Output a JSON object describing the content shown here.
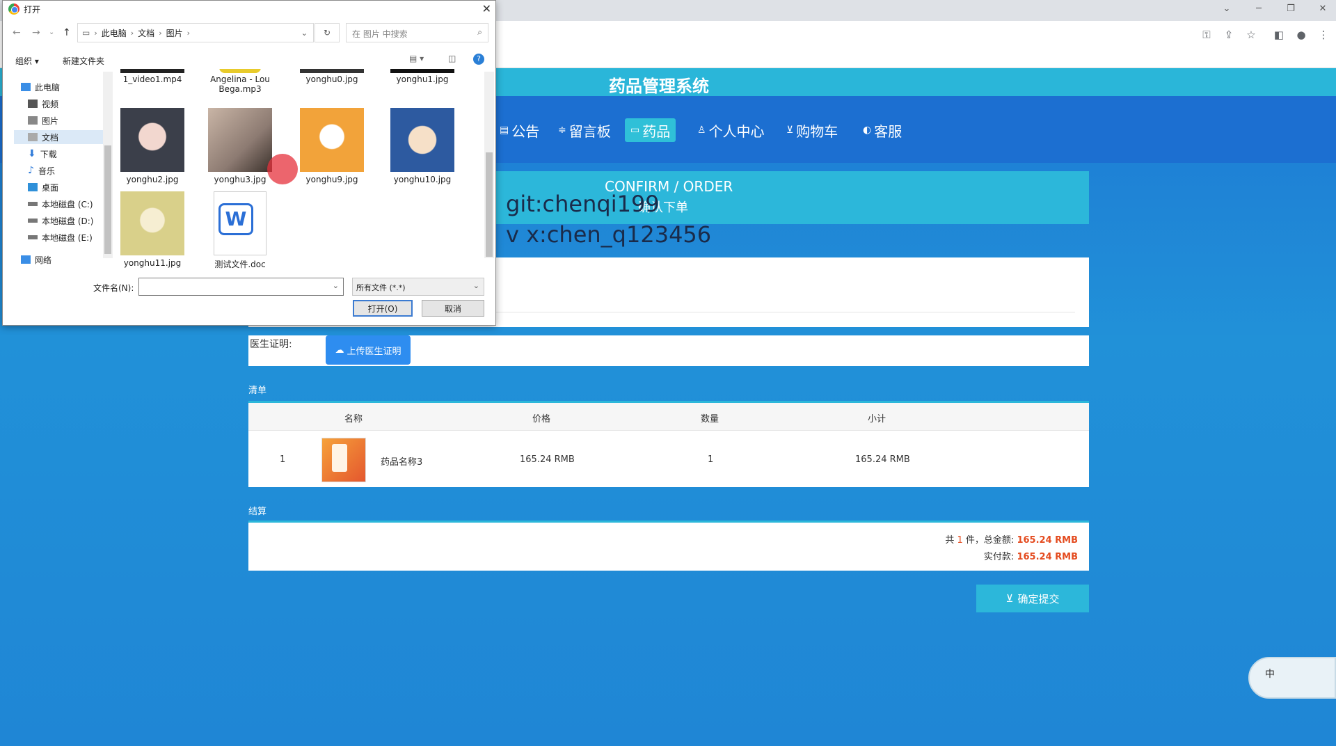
{
  "browser": {
    "window_controls": {
      "dropdown": "⌄",
      "minimize": "─",
      "restore": "❐",
      "close": "✕"
    },
    "toolbar_icons": [
      "key-icon",
      "share-icon",
      "star-icon",
      "sidebar-icon",
      "profile-icon",
      "menu-icon"
    ]
  },
  "site": {
    "title": "药品管理系统",
    "nav": [
      {
        "icon": "▤",
        "label": "公告"
      },
      {
        "icon": "≑",
        "label": "留言板"
      },
      {
        "icon": "▭",
        "label": "药品"
      },
      {
        "icon": "♙",
        "label": "个人中心"
      },
      {
        "icon": "⊻",
        "label": "购物车"
      },
      {
        "icon": "◐",
        "label": "客服"
      }
    ]
  },
  "confirm": {
    "title": "CONFIRM / ORDER",
    "subtitle": "确认下单",
    "overlay_git": "git:chenqi199",
    "overlay_vx": "v x:chen_q123456"
  },
  "doctor": {
    "label": "医生证明:",
    "upload_button": "上传医生证明"
  },
  "list": {
    "section_label": "清单",
    "headers": [
      "名称",
      "价格",
      "数量",
      "小计"
    ],
    "rows": [
      {
        "index": "1",
        "name": "药品名称3",
        "price": "165.24 RMB",
        "qty": "1",
        "subtotal": "165.24 RMB"
      }
    ]
  },
  "settle": {
    "section_label": "结算",
    "line1_prefix": "共",
    "count": "1",
    "line1_mid": "件，总金额:",
    "total": "165.24 RMB",
    "line2_label": "实付款:",
    "paid": "165.24 RMB",
    "submit": "确定提交"
  },
  "ime": {
    "label": "中"
  },
  "dialog": {
    "title": "打开",
    "breadcrumb": [
      "此电脑",
      "文档",
      "图片"
    ],
    "search_placeholder": "在 图片 中搜索",
    "organize": "组织 ▾",
    "new_folder": "新建文件夹",
    "tree": [
      {
        "label": "此电脑",
        "color": "#3a8ee6"
      },
      {
        "label": "视频",
        "color": "#555"
      },
      {
        "label": "图片",
        "color": "#555"
      },
      {
        "label": "文档",
        "color": "#777"
      },
      {
        "label": "下载",
        "color": "#2f7bd9"
      },
      {
        "label": "音乐",
        "color": "#2f7bd9"
      },
      {
        "label": "桌面",
        "color": "#2f90d9"
      },
      {
        "label": "本地磁盘 (C:)",
        "color": "#777"
      },
      {
        "label": "本地磁盘 (D:)",
        "color": "#777"
      },
      {
        "label": "本地磁盘 (E:)",
        "color": "#777"
      },
      {
        "label": "网络",
        "color": "#3a8ee6"
      }
    ],
    "files_top": [
      "1_video1.mp4",
      "Angelina - Lou Bega.mp3",
      "yonghu0.jpg",
      "yonghu1.jpg"
    ],
    "files_row2": [
      {
        "name": "yonghu2.jpg",
        "color": "#3b3f4a"
      },
      {
        "name": "yonghu3.jpg",
        "color": "#8d7b72"
      },
      {
        "name": "yonghu9.jpg",
        "color": "#f2a33a"
      },
      {
        "name": "yonghu10.jpg",
        "color": "#2d5aa0"
      }
    ],
    "files_row3": [
      {
        "name": "yonghu11.jpg",
        "color": "#d9d08a"
      },
      {
        "name": "测试文件.doc",
        "color": "#ffffff"
      }
    ],
    "filename_label": "文件名(N):",
    "filename_value": "",
    "filetype": "所有文件 (*.*)",
    "open_button": "打开(O)",
    "cancel_button": "取消"
  }
}
